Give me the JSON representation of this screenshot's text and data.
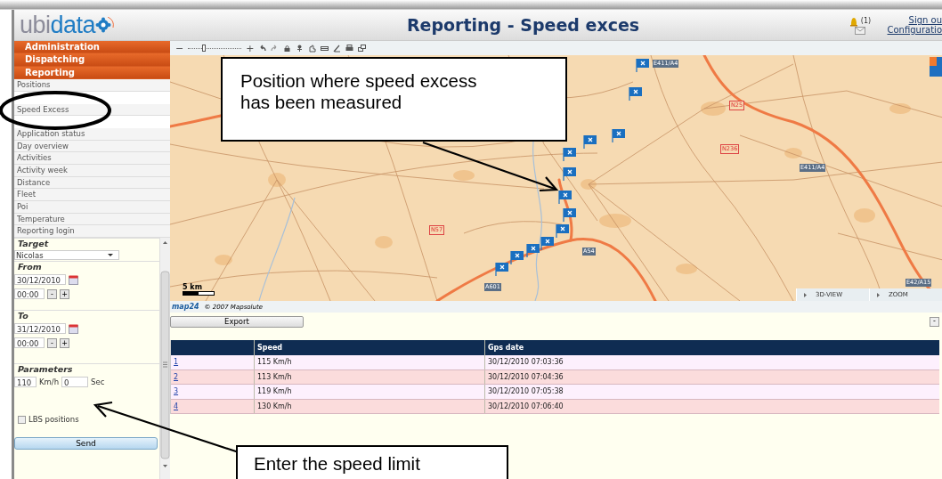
{
  "header": {
    "logo": {
      "part_1": "ubi",
      "part_2": "data"
    },
    "title": "Reporting - Speed exces",
    "alert_count": "(1)",
    "links": [
      "Sign ou",
      "Configuratio"
    ]
  },
  "menu": {
    "sections": [
      "Administration",
      "Dispatching",
      "Reporting"
    ],
    "items": [
      "Positions",
      "Speed Excess",
      "Application status",
      "Day overview",
      "Activities",
      "Activity week",
      "Distance",
      "Fleet",
      "Poi",
      "Temperature",
      "Reporting login"
    ]
  },
  "form": {
    "target": {
      "label": "Target",
      "value": "Nicolas"
    },
    "from": {
      "label": "From",
      "date": "30/12/2010",
      "time": "00:00",
      "minus": "-",
      "plus": "+"
    },
    "to": {
      "label": "To",
      "date": "31/12/2010",
      "time": "00:00",
      "minus": "-",
      "plus": "+"
    },
    "parameters": {
      "label": "Parameters",
      "speed": "110",
      "speed_unit": "Km/h",
      "duration": "0",
      "duration_unit": "Sec"
    },
    "lbs": {
      "label": "LBS positions",
      "checked": false
    },
    "send": "Send"
  },
  "map": {
    "zoom_out": "−",
    "zoom_in": "+",
    "zoom": {
      "level": 0.3
    },
    "road_labels": [
      {
        "text": "E411/A4",
        "kind": "motorway"
      },
      {
        "text": "N25",
        "kind": "national"
      },
      {
        "text": "N236",
        "kind": "national"
      },
      {
        "text": "E411/A4",
        "kind": "motorway"
      },
      {
        "text": "N57",
        "kind": "national"
      },
      {
        "text": "A54",
        "kind": "motorway"
      },
      {
        "text": "A601",
        "kind": "motorway"
      },
      {
        "text": "E42/A15",
        "kind": "motorway"
      }
    ],
    "scale": "5 km",
    "buttons": [
      "3D-VIEW",
      "ZOOM"
    ],
    "credit": {
      "brand": "map24",
      "copyright": "© 2007 Mapsolute"
    }
  },
  "results": {
    "export": "Export",
    "collapse": "-",
    "columns": [
      "Speed",
      "Gps date"
    ],
    "rows": [
      {
        "index": "1",
        "speed": "115 Km/h",
        "date": "30/12/2010 07:03:36"
      },
      {
        "index": "2",
        "speed": "113 Km/h",
        "date": "30/12/2010 07:04:36"
      },
      {
        "index": "3",
        "speed": "119 Km/h",
        "date": "30/12/2010 07:05:38"
      },
      {
        "index": "4",
        "speed": "130 Km/h",
        "date": "30/12/2010 07:06:40"
      }
    ]
  },
  "annotations": [
    {
      "text": "Position where speed excess has been measured"
    },
    {
      "text": "Enter the speed limit"
    }
  ]
}
